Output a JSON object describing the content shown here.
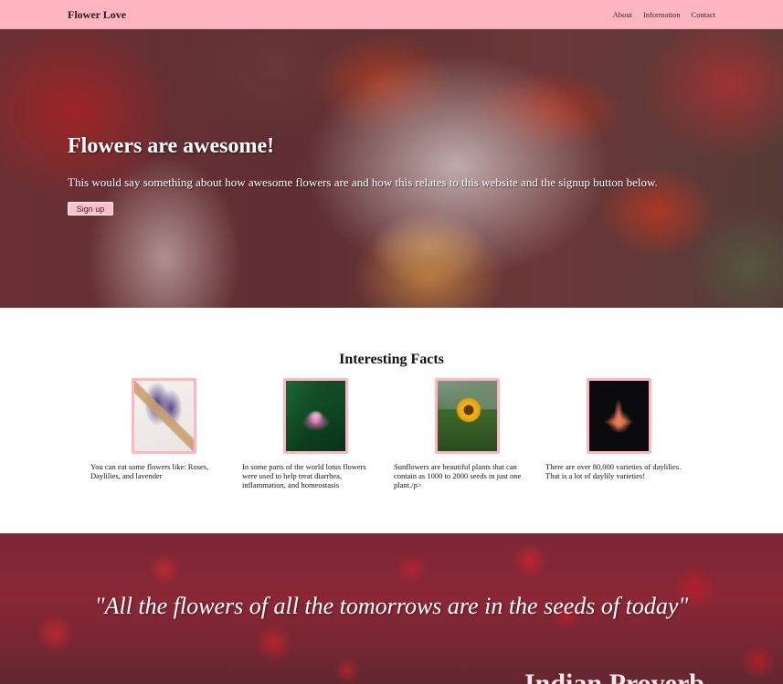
{
  "navbar": {
    "brand": "Flower Love",
    "links": [
      "About",
      "Information",
      "Contact"
    ]
  },
  "hero": {
    "title": "Flowers are awesome!",
    "text": "This would say something about how awesome flowers are and how this relates to this website and the signup button below.",
    "button_label": "Sign up"
  },
  "facts": {
    "title": "Interesting Facts",
    "items": [
      {
        "image": "lavender-bundle-image",
        "text": "You can eat some flowers like: Roses, Daylilies, and lavender"
      },
      {
        "image": "lotus-flower-image",
        "text": "In some parts of the world lotus flowers were used to help treat diarrhea, inflammation, and homeostasis"
      },
      {
        "image": "sunflower-image",
        "text": "Sunflowers are beautiful plants that can contain as 1000 to 2000 seeds in just one plant./p>"
      },
      {
        "image": "daylily-image",
        "text": "There are over 80,000 varieties of daylilies. That is a lot of daylily varieties!"
      }
    ]
  },
  "quote": {
    "text": "\"All the flowers of all the tomorrows are in the seeds of today\"",
    "author": "Indian Proverb"
  },
  "colors": {
    "navbar": "#ffb6c1",
    "button": "#ffc0cb",
    "frame": "#ffb6c1"
  }
}
